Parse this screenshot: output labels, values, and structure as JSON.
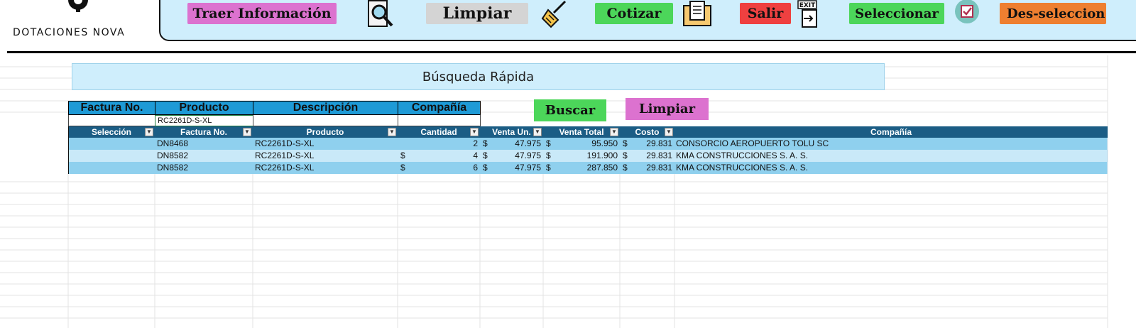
{
  "logo": {
    "text": "DOTACIONES NOVA"
  },
  "toolbar": {
    "traer": "Traer Información",
    "limpiar": "Limpiar",
    "cotizar": "Cotizar",
    "salir": "Salir",
    "exit_sign": "EXIT",
    "seleccionar": "Seleccionar",
    "des_seleccionar": "Des-seleccion"
  },
  "search": {
    "title": "Búsqueda Rápida",
    "headers": [
      "Factura No.",
      "Producto",
      "Descripción",
      "Compañía"
    ],
    "values": [
      "",
      "RC2261D-S-XL",
      "",
      ""
    ],
    "buscar": "Buscar",
    "limpiar": "Limpiar"
  },
  "table": {
    "columns": [
      "Selección",
      "Factura No.",
      "Producto",
      "Cantidad",
      "Venta Un.",
      "Venta Total",
      "Costo",
      "Compañía"
    ],
    "currency": "$",
    "rows": [
      {
        "factura": "DN8468",
        "producto": "RC2261D-S-XL",
        "cantidad": "2",
        "cantidad_cur": "",
        "venta_un": "47.975",
        "venta_total": "95.950",
        "costo": "29.831",
        "compania": "CONSORCIO AEROPUERTO TOLU SC"
      },
      {
        "factura": "DN8582",
        "producto": "RC2261D-S-XL",
        "cantidad": "4",
        "cantidad_cur": "$",
        "venta_un": "47.975",
        "venta_total": "191.900",
        "costo": "29.831",
        "compania": "KMA CONSTRUCCIONES S. A. S."
      },
      {
        "factura": "DN8582",
        "producto": "RC2261D-S-XL",
        "cantidad": "6",
        "cantidad_cur": "$",
        "venta_un": "47.975",
        "venta_total": "287.850",
        "costo": "29.831",
        "compania": "KMA CONSTRUCCIONES S. A. S."
      }
    ]
  },
  "colors": {
    "toolbar_bg": "#cfeefc",
    "pink": "#dc72cf",
    "gray": "#d4d4d4",
    "green": "#4cd65a",
    "red": "#ef4040",
    "orange": "#ee7f30",
    "header_blue": "#1e9ad6",
    "table_head": "#1b5d85"
  }
}
